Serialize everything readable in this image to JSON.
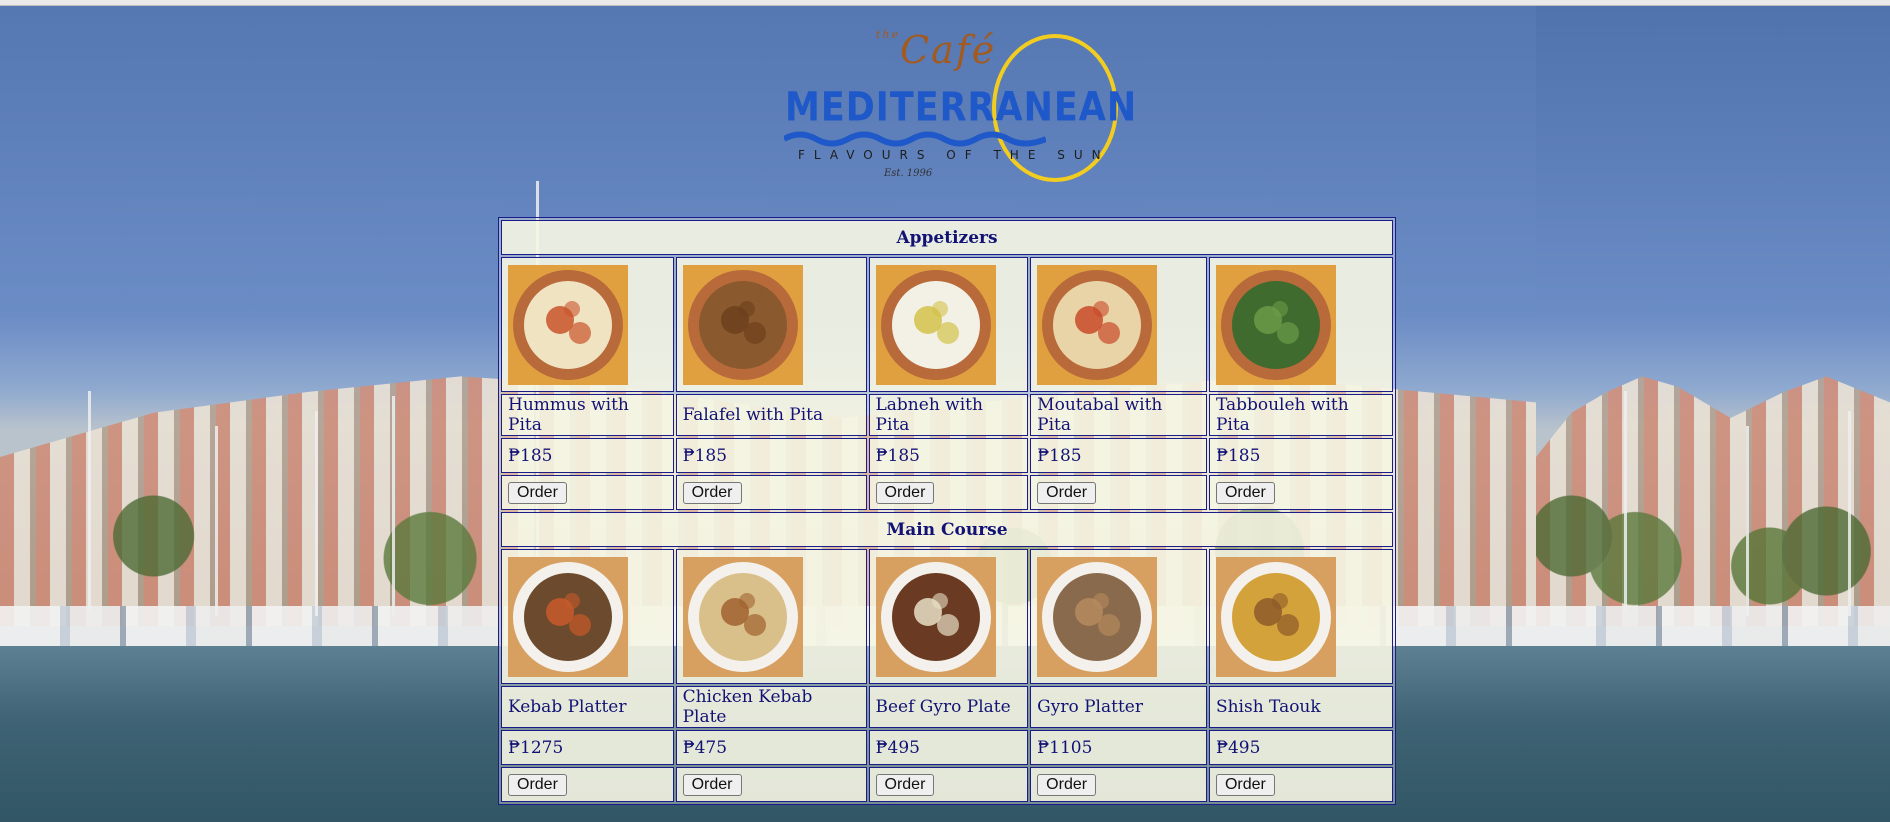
{
  "brand": {
    "prefix": "the",
    "cafe": "Café",
    "name": "MEDITERRANEAN",
    "tagline": "FLAVOURS OF THE SUN",
    "established": "Est. 1996"
  },
  "colors": {
    "table_text": "#121275",
    "table_border": "#1b1b8a",
    "logo_blue": "#1f58c8",
    "logo_yellow": "#f2cd1f",
    "logo_brown": "#a35a1e"
  },
  "sections": [
    {
      "title": "Appetizers",
      "items": [
        {
          "name": "Hummus with Pita",
          "price": "₱185",
          "image_icon": "hummus-plate-icon",
          "button": "Order"
        },
        {
          "name": "Falafel with Pita",
          "price": "₱185",
          "image_icon": "falafel-plate-icon",
          "button": "Order"
        },
        {
          "name": "Labneh with Pita",
          "price": "₱185",
          "image_icon": "labneh-plate-icon",
          "button": "Order"
        },
        {
          "name": "Moutabal with Pita",
          "price": "₱185",
          "image_icon": "moutabal-plate-icon",
          "button": "Order"
        },
        {
          "name": "Tabbouleh with Pita",
          "price": "₱185",
          "image_icon": "tabbouleh-plate-icon",
          "button": "Order"
        }
      ]
    },
    {
      "title": "Main Course",
      "items": [
        {
          "name": "Kebab Platter",
          "price": "₱1275",
          "image_icon": "kebab-platter-icon",
          "button": "Order"
        },
        {
          "name": "Chicken Kebab Plate",
          "price": "₱475",
          "image_icon": "chicken-kebab-plate-icon",
          "button": "Order"
        },
        {
          "name": "Beef Gyro Plate",
          "price": "₱495",
          "image_icon": "beef-gyro-plate-icon",
          "button": "Order"
        },
        {
          "name": "Gyro Platter",
          "price": "₱1105",
          "image_icon": "gyro-platter-icon",
          "button": "Order"
        },
        {
          "name": "Shish Taouk",
          "price": "₱495",
          "image_icon": "shish-taouk-plate-icon",
          "button": "Order"
        }
      ]
    }
  ]
}
